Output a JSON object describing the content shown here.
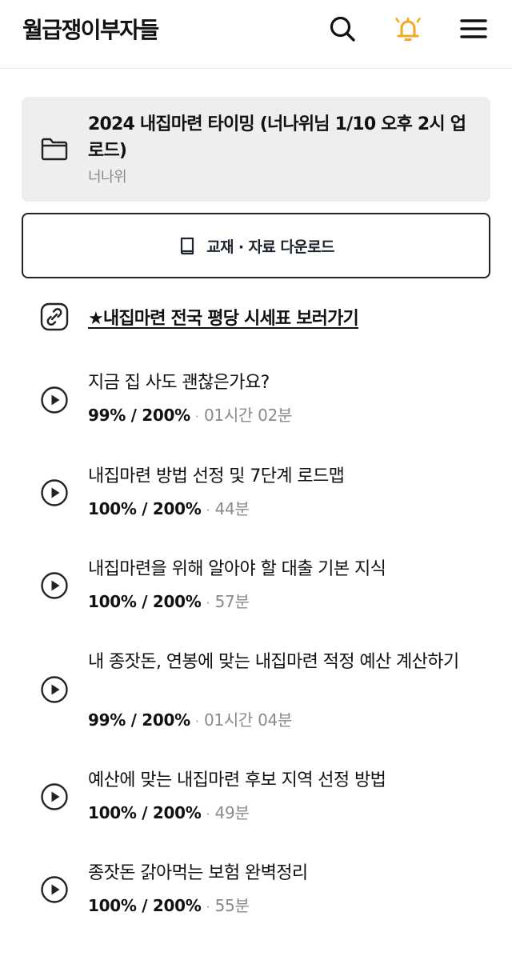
{
  "header": {
    "logo": "월급쟁이부자들",
    "icons": [
      "search-icon",
      "bell-icon",
      "hamburger-menu-icon"
    ],
    "bell_color": "#F5A623"
  },
  "folder": {
    "title": "2024 내집마련 타이밍 (너나위님 1/10 오후 2시 업로드)",
    "author": "너나위"
  },
  "download": {
    "label": "교재 · 자료 다운로드"
  },
  "link": {
    "label": "★내집마련 전국 평당 시세표 보러가기"
  },
  "lessons": [
    {
      "title": "지금 집 사도 괜찮은가요?",
      "progress": "99% / 200%",
      "duration": "01시간 02분"
    },
    {
      "title": "내집마련 방법 선정 및 7단계 로드맵",
      "progress": "100% / 200%",
      "duration": "44분"
    },
    {
      "title": "내집마련을 위해 알아야 할 대출 기본 지식",
      "progress": "100% / 200%",
      "duration": "57분"
    },
    {
      "title": "내 종잣돈, 연봉에 맞는 내집마련 적정 예산 계산하기",
      "progress": "99% / 200%",
      "duration": "01시간 04분"
    },
    {
      "title": "예산에 맞는 내집마련 후보 지역 선정 방법",
      "progress": "100% / 200%",
      "duration": "49분"
    },
    {
      "title": "종잣돈 갉아먹는 보험 완벽정리",
      "progress": "100% / 200%",
      "duration": "55분"
    }
  ],
  "separator": "·"
}
